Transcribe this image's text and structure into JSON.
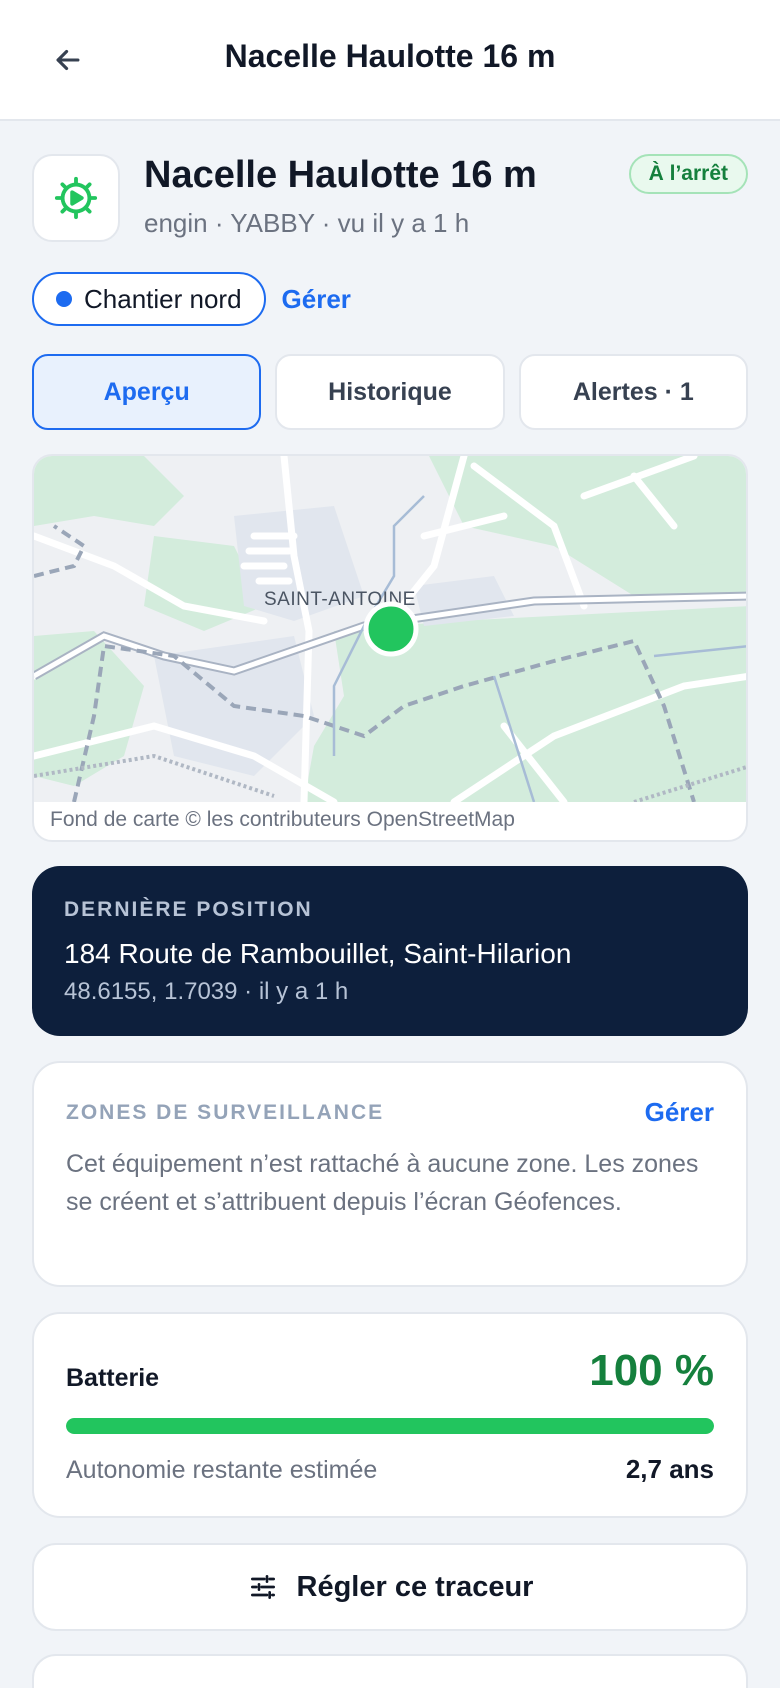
{
  "topbar": {
    "title": "Nacelle Haulotte 16 m",
    "back_icon": "arrow-left-icon"
  },
  "device": {
    "name": "Nacelle Haulotte 16 m",
    "meta": "engin · YABBY · vu il y a 1 h",
    "status": "À l’arrêt",
    "icon": "gear-play-icon",
    "accent": "#22c55e"
  },
  "group": {
    "label": "Chantier nord",
    "manage": "Gérer"
  },
  "tabs": [
    {
      "label": "Aperçu",
      "active": true
    },
    {
      "label": "Historique",
      "active": false
    },
    {
      "label": "Alertes · 1",
      "active": false
    }
  ],
  "map": {
    "place_label": "SAINT-ANTOINE",
    "attribution": "Fond de carte © les contributeurs OpenStreetMap"
  },
  "position": {
    "label": "DERNIÈRE POSITION",
    "address": "184 Route de Rambouillet, Saint-Hilarion",
    "coords": "48.6155, 1.7039 · il y a 1 h"
  },
  "zones": {
    "title": "ZONES DE SURVEILLANCE",
    "manage": "Gérer",
    "text": "Cet équipement n’est rattaché à aucune zone. Les zones se créent et s’attribuent depuis l’écran Géofences."
  },
  "battery": {
    "label": "Batterie",
    "value": "100 %",
    "level": 1.0,
    "sub_label": "Autonomie restante estimée",
    "life": "2,7 ans"
  },
  "actions": {
    "settings_label": "Régler ce traceur",
    "settings_icon": "sliders-icon"
  },
  "colors": {
    "primary": "#1d6bf0",
    "dark_card": "#0d1f3c",
    "success": "#15803d"
  }
}
